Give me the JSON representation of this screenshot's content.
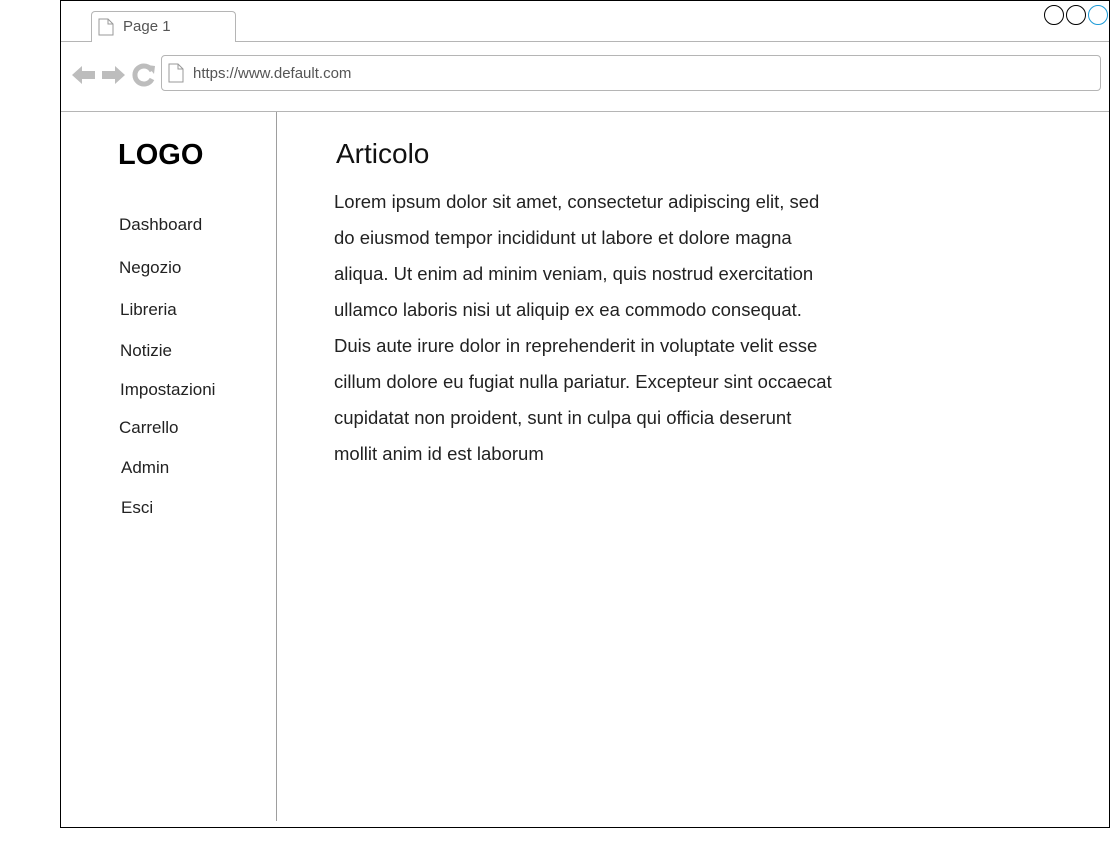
{
  "browser": {
    "tab_title": "Page 1",
    "url": "https://www.default.com",
    "window_controls": [
      "circle",
      "circle",
      "circle-accent"
    ],
    "accent_color": "#1d9bd7"
  },
  "sidebar": {
    "logo": "LOGO",
    "items": [
      {
        "label": "Dashboard"
      },
      {
        "label": "Negozio"
      },
      {
        "label": "Libreria"
      },
      {
        "label": "Notizie"
      },
      {
        "label": "Impostazioni"
      },
      {
        "label": "Carrello"
      },
      {
        "label": "Admin"
      },
      {
        "label": "Esci"
      }
    ]
  },
  "main": {
    "title": "Articolo",
    "body": "Lorem ipsum dolor sit amet, consectetur adipiscing elit, sed do eiusmod tempor incididunt ut labore et dolore magna aliqua. Ut enim ad minim veniam, quis nostrud exercitation ullamco laboris nisi ut aliquip ex ea commodo consequat. Duis aute irure dolor in reprehenderit in voluptate velit esse cillum dolore eu fugiat nulla pariatur. Excepteur sint occaecat cupidatat non proident, sunt in culpa qui officia deserunt mollit anim id est laborum"
  }
}
